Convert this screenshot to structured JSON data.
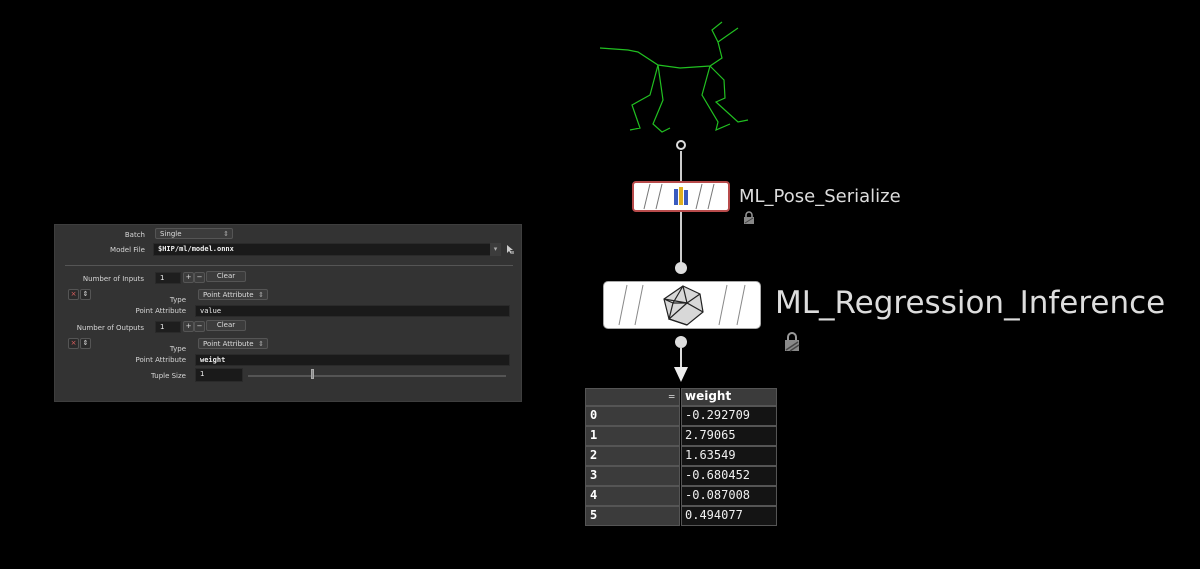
{
  "params": {
    "batch_label": "Batch",
    "batch_value": "Single",
    "model_file_label": "Model File",
    "model_file_value": "$HIP/ml/model.onnx",
    "num_inputs_label": "Number of Inputs",
    "num_inputs_value": "1",
    "num_outputs_label": "Number of Outputs",
    "num_outputs_value": "1",
    "plus_label": "+",
    "minus_label": "−",
    "clear_label": "Clear",
    "remove_glyph": "×",
    "reorder_glyph": "⇕",
    "dropdown_arrow": "▾",
    "menu_arrow": "⇕",
    "inputs": [
      {
        "type_label": "Type",
        "type_value": "Point Attribute",
        "attr_label": "Point Attribute",
        "attr_value": "value"
      }
    ],
    "outputs": [
      {
        "type_label": "Type",
        "type_value": "Point Attribute",
        "attr_label": "Point Attribute",
        "attr_value": "weight",
        "tuple_label": "Tuple Size",
        "tuple_value": "1"
      }
    ]
  },
  "graph": {
    "node1_name": "ML_Pose_Serialize",
    "node2_name": "ML_Regression_Inference",
    "skeleton_color": "#21c021",
    "node1_border_color": "#b84b4b"
  },
  "spreadsheet": {
    "index_header": "=",
    "column_header": "weight",
    "rows": [
      {
        "index": "0",
        "value": "-0.292709"
      },
      {
        "index": "1",
        "value": "2.79065"
      },
      {
        "index": "2",
        "value": "1.63549"
      },
      {
        "index": "3",
        "value": "-0.680452"
      },
      {
        "index": "4",
        "value": "-0.087008"
      },
      {
        "index": "5",
        "value": "0.494077"
      }
    ]
  },
  "icons": [
    "file-browse-icon",
    "lock-icon",
    "polyhedron-icon",
    "serialize-icon"
  ]
}
